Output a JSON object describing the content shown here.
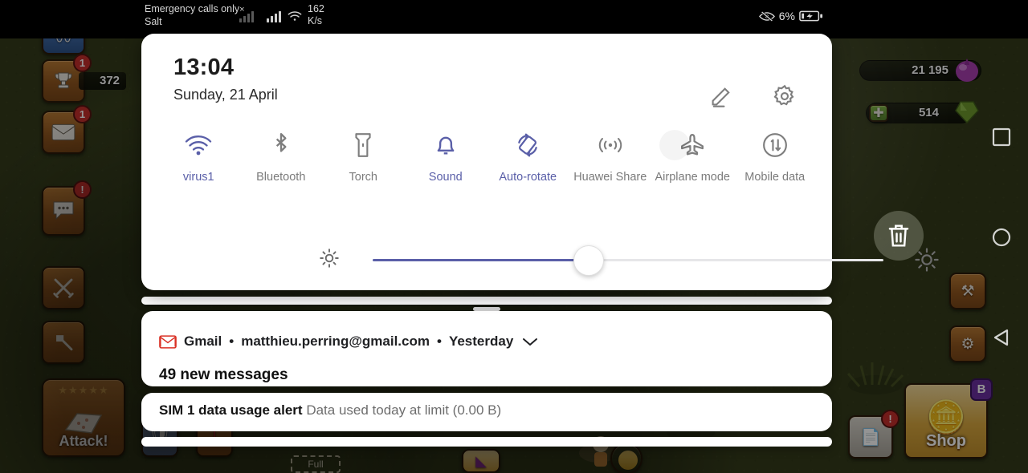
{
  "status_bar": {
    "carrier": "Emergency calls only",
    "carrier_close": "×",
    "sub_carrier": "Salt",
    "sim1_icon": "signal-bars-empty-icon",
    "sim2_icon": "signal-bars-full-icon",
    "wifi_icon": "wifi-icon",
    "data_rate_value": "162",
    "data_rate_unit": "K/s",
    "eyecare_icon": "eye-comfort-icon",
    "battery_percent": "6%",
    "battery_icon": "battery-charging-icon"
  },
  "quick_settings": {
    "clock": "13:04",
    "date": "Sunday, 21 April",
    "edit_icon": "pencil-edit-icon",
    "settings_icon": "gear-icon",
    "drag_handle": "drag-handle",
    "tiles": [
      {
        "label": "virus1",
        "icon": "wifi-icon",
        "active": true
      },
      {
        "label": "Bluetooth",
        "icon": "bluetooth-icon",
        "active": false
      },
      {
        "label": "Torch",
        "icon": "flashlight-icon",
        "active": false
      },
      {
        "label": "Sound",
        "icon": "bell-icon",
        "active": true
      },
      {
        "label": "Auto-rotate",
        "icon": "auto-rotate-icon",
        "active": true
      },
      {
        "label": "Huawei Share",
        "icon": "huawei-share-icon",
        "active": false
      },
      {
        "label": "Airplane mode",
        "icon": "airplane-icon",
        "active": false
      },
      {
        "label": "Mobile data",
        "icon": "mobile-data-icon",
        "active": false
      }
    ],
    "brightness": {
      "low_icon": "brightness-low-icon",
      "high_icon": "brightness-high-icon",
      "value_percent": 42
    }
  },
  "notifications": [
    {
      "app_icon": "gmail-icon",
      "app": "Gmail",
      "separator": "•",
      "account": "matthieu.perring@gmail.com",
      "time": "Yesterday",
      "expand_icon": "chevron-down-icon",
      "body": "49 new messages"
    },
    {
      "title": "SIM 1 data usage alert",
      "text": "Data used today at limit (0.00 B)"
    }
  ],
  "game_background": {
    "left_buttons": [
      {
        "name": "stats-button",
        "glyph": "〜",
        "badge": ""
      },
      {
        "name": "trophy-button",
        "glyph": "Ἴ6",
        "badge": "1"
      },
      {
        "name": "mail-button",
        "glyph": "✉",
        "badge": "1"
      },
      {
        "name": "chat-button",
        "glyph": "…",
        "badge": "!"
      },
      {
        "name": "battle-button",
        "glyph": "⚔",
        "badge": ""
      },
      {
        "name": "builder-button",
        "glyph": "⚒",
        "badge": ""
      }
    ],
    "trophy_count": "372",
    "attack_label": "Attack!",
    "attack_stars": "★★★★★",
    "resources": [
      {
        "name": "elixir",
        "value": "21 195"
      },
      {
        "name": "dark-elixir",
        "value": "514"
      }
    ],
    "shop_label": "Shop",
    "shop_badge": "B",
    "trash_icon": "trash-icon",
    "nav": {
      "recents_icon": "recents-square-icon",
      "home_icon": "home-circle-icon",
      "back_icon": "back-triangle-icon"
    }
  }
}
